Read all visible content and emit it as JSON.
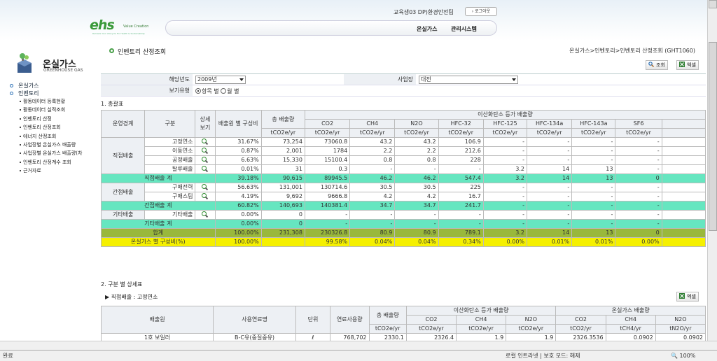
{
  "header": {
    "user_info": "교육생03 DP)환경안전팀",
    "logout_label": "로그아웃",
    "logo_mark": "ehs",
    "logo_sub": "Value Creation",
    "logo_tag": "Remade Your Lifecycle For Health & Sustainability",
    "nav": [
      "온실가스",
      "관리시스템"
    ]
  },
  "sidebar": {
    "title": "온실가스",
    "subtitle": "GREENHOUSE GAS",
    "menu": [
      {
        "label": "온실가스",
        "level": 1
      },
      {
        "label": "인벤토리",
        "level": 1
      },
      {
        "label": "활동데이터 등록현황",
        "level": 2
      },
      {
        "label": "활동데이터 실적조회",
        "level": 2
      },
      {
        "label": "인벤토리 산정",
        "level": 2
      },
      {
        "label": "인벤토리 산정조회",
        "level": 2
      },
      {
        "label": "에너지 산정조회",
        "level": 2
      },
      {
        "label": "사업장별 온실가스 배출량",
        "level": 2
      },
      {
        "label": "사업장별 온실가스 배출량(차",
        "level": 2
      },
      {
        "label": "인벤토리 산정계수 조회",
        "level": 2
      },
      {
        "label": "근거자료",
        "level": 2
      }
    ]
  },
  "page": {
    "title": "인벤토리 산정조회",
    "breadcrumb": "온실가스>인벤토리>인벤토리 산정조회 (GHT1060)",
    "search_button": "조회",
    "excel_button": "엑셀"
  },
  "filters": {
    "year_label": "해당년도",
    "year_value": "2009년",
    "site_label": "사업장",
    "site_value": "대전",
    "view_label": "보기유형",
    "view_options": [
      "항목 별",
      "월 별"
    ],
    "view_selected": 0
  },
  "summary": {
    "section_title": "1. 총괄표",
    "headers": {
      "op_boundary": "운영경계",
      "category": "구분",
      "detail": "상세보기",
      "ratio": "배출원 별 구성비",
      "total": "총 배출량",
      "total_unit": "tCO2e/yr",
      "co2eq_group": "이산화탄소 등가 배출량",
      "gases": [
        "CO2",
        "CH4",
        "N2O",
        "HFC-32",
        "HFC-125",
        "HFC-134a",
        "HFC-143a",
        "SF6"
      ],
      "gas_unit": "tCO2e/yr"
    },
    "groups": [
      {
        "name": "직접배출",
        "rows": [
          {
            "label": "고정연소",
            "ratio": "31.67%",
            "total": "73,254",
            "values": [
              "73060.8",
              "43.2",
              "43.2",
              "106.9",
              "-",
              "-",
              "-",
              "-"
            ]
          },
          {
            "label": "이동연소",
            "ratio": "0.87%",
            "total": "2,001",
            "values": [
              "1784",
              "2.2",
              "2.2",
              "212.6",
              "-",
              "-",
              "-",
              "-"
            ]
          },
          {
            "label": "공정배출",
            "ratio": "6.63%",
            "total": "15,330",
            "values": [
              "15100.4",
              "0.8",
              "0.8",
              "228",
              "-",
              "-",
              "-",
              "-"
            ]
          },
          {
            "label": "탈루배출",
            "ratio": "0.01%",
            "total": "31",
            "values": [
              "0.3",
              "-",
              "-",
              "-",
              "3.2",
              "14",
              "13",
              "-"
            ]
          }
        ],
        "subtotal": {
          "label": "직접배출 계",
          "ratio": "39.18%",
          "total": "90,615",
          "values": [
            "89945.5",
            "46.2",
            "46.2",
            "547.4",
            "3.2",
            "14",
            "13",
            "0"
          ]
        }
      },
      {
        "name": "간접배출",
        "rows": [
          {
            "label": "구매전력",
            "ratio": "56.63%",
            "total": "131,001",
            "values": [
              "130714.6",
              "30.5",
              "30.5",
              "225",
              "-",
              "-",
              "-",
              "-"
            ]
          },
          {
            "label": "구매스팀",
            "ratio": "4.19%",
            "total": "9,692",
            "values": [
              "9666.8",
              "4.2",
              "4.2",
              "16.7",
              "-",
              "-",
              "-",
              "-"
            ]
          }
        ],
        "subtotal": {
          "label": "간접배출 계",
          "ratio": "60.82%",
          "total": "140,693",
          "values": [
            "140381.4",
            "34.7",
            "34.7",
            "241.7",
            "-",
            "-",
            "-",
            "-"
          ]
        }
      },
      {
        "name": "기타배출",
        "rows": [
          {
            "label": "기타배출",
            "ratio": "0.00%",
            "total": "0",
            "values": [
              "-",
              "-",
              "-",
              "-",
              "-",
              "-",
              "-",
              "-"
            ]
          }
        ],
        "subtotal": {
          "label": "기타배출 계",
          "ratio": "0.00%",
          "total": "0",
          "values": [
            "-",
            "-",
            "-",
            "-",
            "-",
            "-",
            "-",
            "-"
          ]
        }
      }
    ],
    "grand_total": {
      "label": "합계",
      "ratio": "100.00%",
      "total": "231,308",
      "values": [
        "230326.8",
        "80.9",
        "80.9",
        "789.1",
        "3.2",
        "14",
        "13",
        "0"
      ]
    },
    "ghg_ratio": {
      "label": "온실가스 별 구성비(%)",
      "ratio": "100.00%",
      "total": "",
      "values": [
        "99.58%",
        "0.04%",
        "0.04%",
        "0.34%",
        "0.00%",
        "0.01%",
        "0.01%",
        "0.00%"
      ]
    }
  },
  "detail": {
    "section_title": "2. 구분 별 상세표",
    "subsection": "▶ 직접배출 : 고정연소",
    "excel_button": "엑셀",
    "headers": {
      "source": "배출원",
      "fuel": "사용연료명",
      "unit": "단위",
      "usage": "연료사용량",
      "total": "총 배출량",
      "total_unit": "tCO2e/yr",
      "co2eq_group": "이산화탄소 등가 배출량",
      "co2eq_gases": [
        "CO2",
        "CH4",
        "N2O"
      ],
      "co2eq_units": [
        "tCO2e/yr",
        "tCO2e/yr",
        "tCO2e/yr"
      ],
      "ghg_group": "온실가스 배출량",
      "ghg_gases": [
        "CO2",
        "CH4",
        "N2O"
      ],
      "ghg_units": [
        "tCO2/yr",
        "tCH4/yr",
        "tN2O/yr"
      ]
    },
    "rows": [
      {
        "source": "1호 보일러",
        "fuel": "B-C유(중질중유)",
        "unit": "ℓ",
        "usage": "768,702",
        "total": "2330.1",
        "co2eq": [
          "2326.4",
          "1.9",
          "1.9"
        ],
        "ghg": [
          "2326.3536",
          "0.0902",
          "0.0902"
        ]
      }
    ]
  },
  "statusbar": {
    "left": "완료",
    "zone": "로컬 인트라넷 | 보호 모드: 해제",
    "zoom": "100%"
  }
}
